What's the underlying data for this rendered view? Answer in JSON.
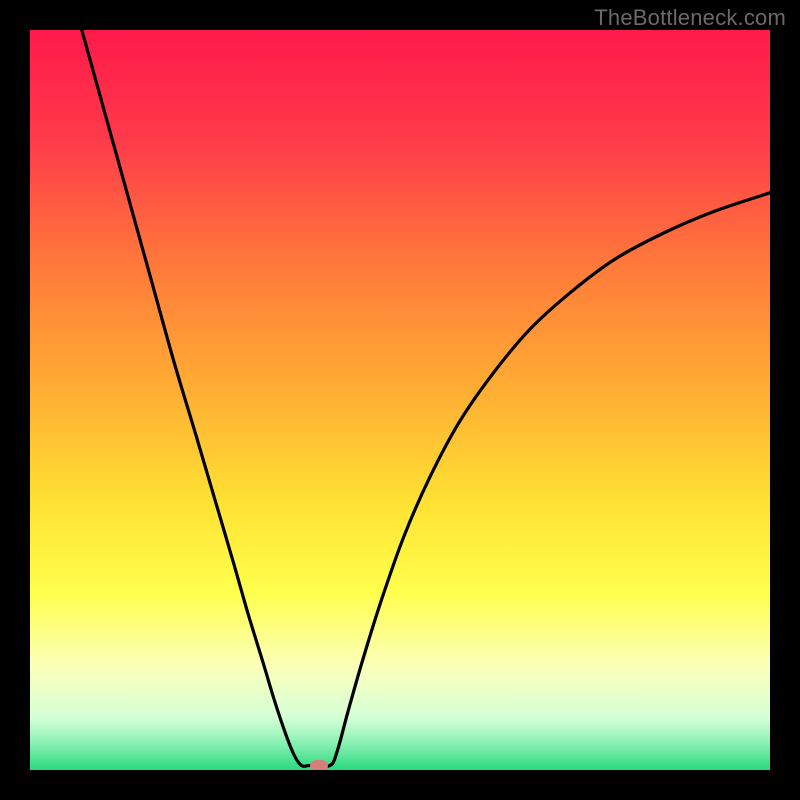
{
  "watermark": "TheBottleneck.com",
  "chart_data": {
    "type": "line",
    "title": "",
    "xlabel": "",
    "ylabel": "",
    "xlim": [
      0,
      100
    ],
    "ylim": [
      0,
      100
    ],
    "grid": false,
    "legend": false,
    "gradient_stops": [
      {
        "offset": 0.0,
        "color": "#ff1a4b"
      },
      {
        "offset": 0.15,
        "color": "#ff3b4a"
      },
      {
        "offset": 0.32,
        "color": "#ff7a3a"
      },
      {
        "offset": 0.5,
        "color": "#ffb233"
      },
      {
        "offset": 0.64,
        "color": "#ffe233"
      },
      {
        "offset": 0.76,
        "color": "#ffff4d"
      },
      {
        "offset": 0.86,
        "color": "#fbffb9"
      },
      {
        "offset": 0.93,
        "color": "#d4ffd6"
      },
      {
        "offset": 0.965,
        "color": "#86f0b0"
      },
      {
        "offset": 1.0,
        "color": "#28d980"
      }
    ],
    "series": [
      {
        "name": "bottleneck-curve",
        "color": "#000000",
        "x": [
          7.0,
          9.5,
          12.0,
          14.5,
          17.0,
          19.5,
          22.5,
          25.0,
          27.5,
          29.5,
          31.5,
          33.0,
          34.5,
          35.7,
          36.7,
          37.8,
          40.5,
          41.5,
          43.0,
          45.0,
          47.5,
          50.5,
          54.0,
          58.0,
          62.5,
          67.5,
          73.0,
          79.0,
          85.5,
          92.5,
          100.0
        ],
        "y": [
          100.0,
          91.0,
          82.0,
          73.0,
          64.0,
          55.0,
          45.0,
          36.5,
          28.0,
          21.0,
          14.5,
          9.5,
          5.0,
          2.0,
          0.6,
          0.6,
          0.6,
          2.5,
          8.0,
          15.0,
          23.0,
          31.5,
          39.5,
          47.0,
          53.5,
          59.5,
          64.5,
          69.0,
          72.5,
          75.5,
          78.0
        ]
      }
    ],
    "marker": {
      "x": 39.1,
      "y": 0.6,
      "color": "#d47f7a"
    }
  }
}
